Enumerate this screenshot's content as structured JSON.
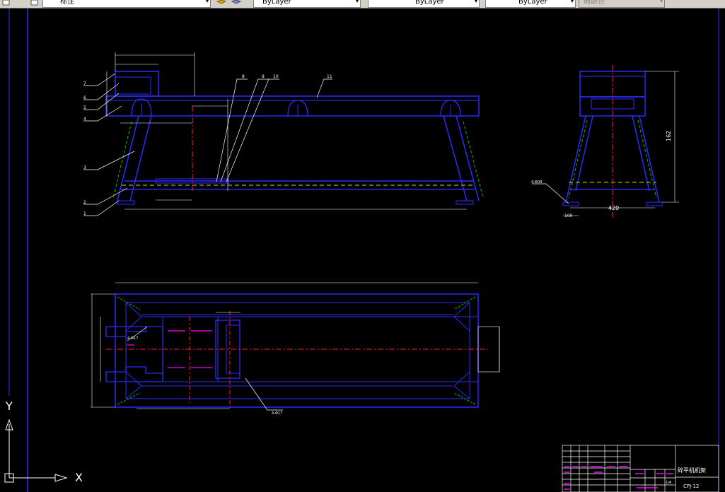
{
  "toolbar": {
    "style_combo": "标注",
    "layer_combos": [
      "ByLayer",
      "ByLayer",
      "ByLayer"
    ],
    "plot_style": "随颜色"
  },
  "ucs": {
    "x_label": "X",
    "y_label": "Y"
  },
  "colors": {
    "frame": "#2b2bff",
    "center": "#ff2020",
    "leader": "#ffffff",
    "dim": "#ffffff",
    "hidden": "#00c000",
    "magenta": "#ff00ff"
  },
  "front_view": {
    "callouts": [
      "1",
      "2",
      "3",
      "4",
      "5",
      "6",
      "7",
      "8",
      "9",
      "10",
      "11"
    ]
  },
  "side_view": {
    "dim_height": "162",
    "dim_width": "420",
    "dim_foot": "100",
    "hole_note": "4-Φ08"
  },
  "plan_view": {
    "hole_note_1": "4-Φ17",
    "hole_note_2": "4-Φ17"
  },
  "title_block": {
    "drawing_name": "碎平机机架",
    "drawing_no": "CPJ-12",
    "sheet": "1/4"
  }
}
